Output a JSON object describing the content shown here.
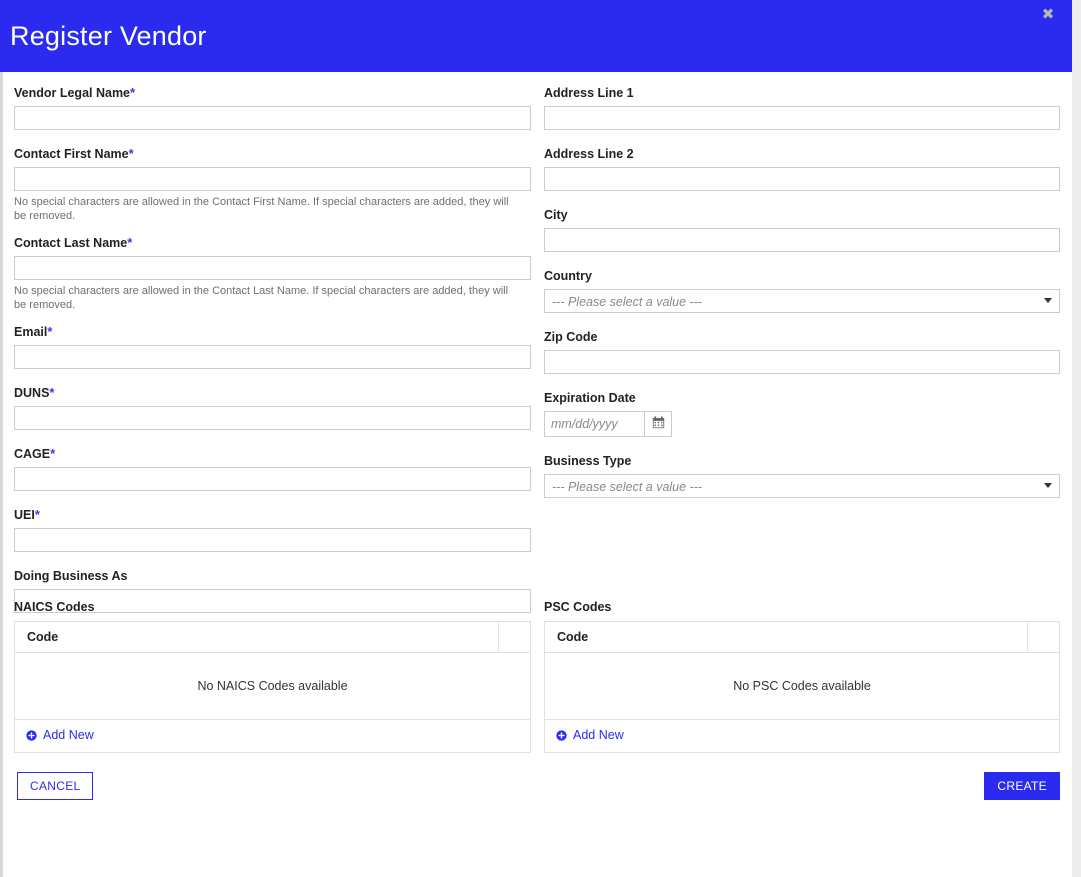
{
  "header": {
    "title": "Register Vendor",
    "close_label": "✖"
  },
  "form": {
    "left": {
      "vendor_legal_name": {
        "label": "Vendor Legal Name",
        "required": "*",
        "value": ""
      },
      "contact_first_name": {
        "label": "Contact First Name",
        "required": "*",
        "value": "",
        "helper": "No special characters are allowed in the Contact First Name. If special characters are added, they will be removed."
      },
      "contact_last_name": {
        "label": "Contact Last Name",
        "required": "*",
        "value": "",
        "helper": "No special characters are allowed in the Contact Last Name. If special characters are added, they will be removed."
      },
      "email": {
        "label": "Email",
        "required": "*",
        "value": ""
      },
      "duns": {
        "label": "DUNS",
        "required": "*",
        "value": ""
      },
      "cage": {
        "label": "CAGE",
        "required": "*",
        "value": ""
      },
      "uei": {
        "label": "UEI",
        "required": "*",
        "value": ""
      },
      "doing_business_as": {
        "label": "Doing Business As",
        "required": "",
        "value": ""
      }
    },
    "right": {
      "address_line_1": {
        "label": "Address Line 1",
        "required": "",
        "value": ""
      },
      "address_line_2": {
        "label": "Address Line 2",
        "required": "",
        "value": ""
      },
      "city": {
        "label": "City",
        "required": "",
        "value": ""
      },
      "country": {
        "label": "Country",
        "required": "",
        "selected": "--- Please select a value ---"
      },
      "zip_code": {
        "label": "Zip Code",
        "required": "",
        "value": ""
      },
      "expiration_date": {
        "label": "Expiration Date",
        "required": "",
        "value": "",
        "placeholder": "mm/dd/yyyy"
      },
      "business_type": {
        "label": "Business Type",
        "required": "",
        "selected": "--- Please select a value ---"
      }
    }
  },
  "naics": {
    "title": "NAICS Codes",
    "columns": [
      "Code"
    ],
    "empty_message": "No NAICS Codes available",
    "add_new_label": "Add New"
  },
  "psc": {
    "title": "PSC Codes",
    "columns": [
      "Code"
    ],
    "empty_message": "No PSC Codes available",
    "add_new_label": "Add New"
  },
  "footer": {
    "cancel_label": "CANCEL",
    "create_label": "CREATE"
  },
  "colors": {
    "accent": "#2b2bef",
    "border": "#cccccc",
    "table_border": "#e0e0e0",
    "helper_text": "#707070",
    "placeholder": "#8a8a8a"
  }
}
